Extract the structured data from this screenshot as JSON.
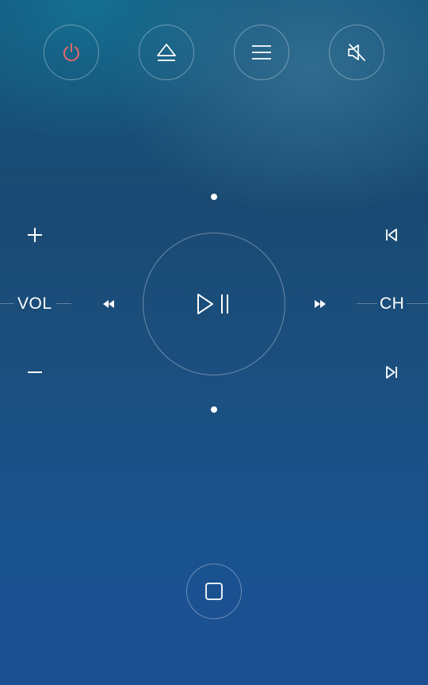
{
  "colors": {
    "power_accent": "#e46a6a",
    "icon": "#ffffff",
    "ring": "rgba(255,255,255,0.35)"
  },
  "top_bar": {
    "buttons": [
      {
        "name": "power",
        "icon": "power-icon"
      },
      {
        "name": "eject",
        "icon": "eject-icon"
      },
      {
        "name": "menu",
        "icon": "menu-icon"
      },
      {
        "name": "mute",
        "icon": "mute-icon"
      }
    ]
  },
  "volume": {
    "label": "VOL",
    "up_icon": "plus-icon",
    "down_icon": "minus-icon"
  },
  "channel": {
    "label": "CH",
    "prev_icon": "skip-previous-icon",
    "next_icon": "skip-next-icon"
  },
  "transport": {
    "rewind_icon": "rewind-icon",
    "fast_forward_icon": "fast-forward-icon",
    "play_pause_icon": "play-pause-icon"
  },
  "bottom": {
    "stop_icon": "stop-icon"
  }
}
